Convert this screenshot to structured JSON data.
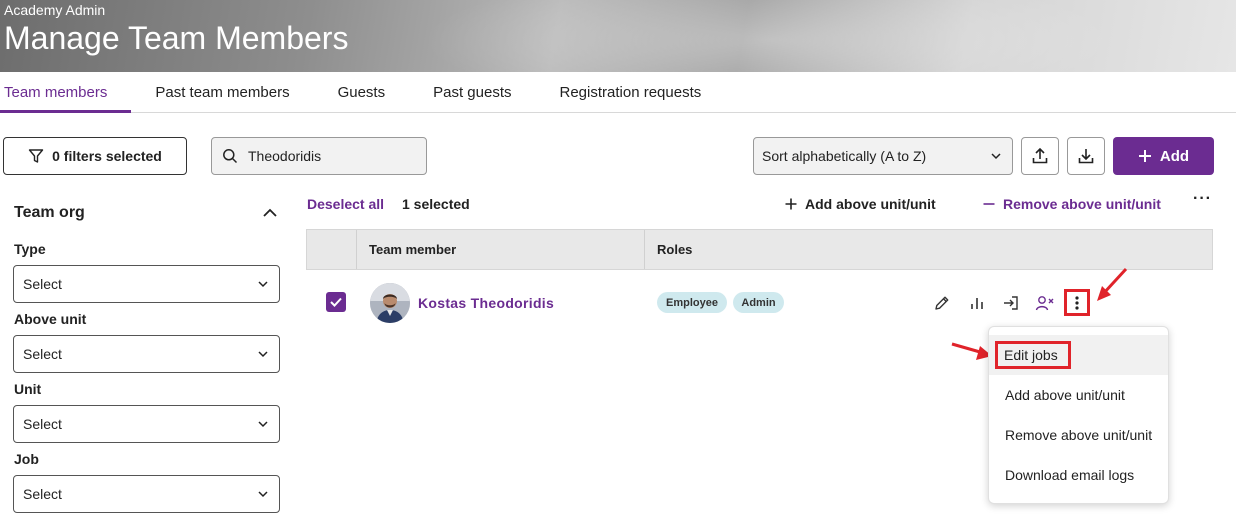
{
  "header": {
    "subtitle": "Academy Admin",
    "title": "Manage Team Members"
  },
  "tabs": [
    {
      "label": "Team members",
      "active": true
    },
    {
      "label": "Past team members",
      "active": false
    },
    {
      "label": "Guests",
      "active": false
    },
    {
      "label": "Past guests",
      "active": false
    },
    {
      "label": "Registration requests",
      "active": false
    }
  ],
  "toolbar": {
    "filters_label": "0 filters selected",
    "search_value": "Theodoridis",
    "sort_value": "Sort alphabetically (A to Z)",
    "upload_icon": "upload-icon",
    "download_icon": "download-icon",
    "add_label": "Add"
  },
  "sidebar": {
    "title": "Team org",
    "fields": [
      {
        "label": "Type",
        "value": "Select"
      },
      {
        "label": "Above unit",
        "value": "Select"
      },
      {
        "label": "Unit",
        "value": "Select"
      },
      {
        "label": "Job",
        "value": "Select"
      }
    ]
  },
  "selection": {
    "deselect_label": "Deselect all",
    "count_label": "1 selected",
    "add_above_label": "Add above unit/unit",
    "remove_above_label": "Remove above unit/unit"
  },
  "table": {
    "columns": [
      "Team member",
      "Roles"
    ],
    "rows": [
      {
        "name": "Kostas Theodoridis",
        "roles": [
          "Employee",
          "Admin"
        ],
        "selected": true
      }
    ]
  },
  "row_menu": {
    "items": [
      "Edit jobs",
      "Add above unit/unit",
      "Remove above unit/unit",
      "Download email logs"
    ]
  },
  "colors": {
    "accent": "#6b2c91",
    "highlight": "#e0232a",
    "badge": "#cfe9ee"
  }
}
